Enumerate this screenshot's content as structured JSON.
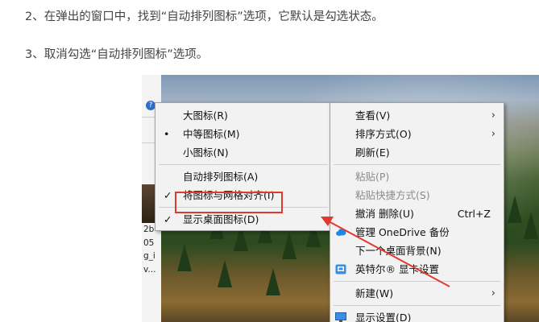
{
  "instructions": {
    "step2": "2、在弹出的窗口中，找到“自动排列图标”选项，它默认是勾选状态。",
    "step3": "3、取消勾选“自动排列图标”选项。"
  },
  "left_strip": {
    "help_glyph": "?",
    "fragments": [
      "2b",
      "05",
      "g_i",
      "v..."
    ]
  },
  "view_submenu": {
    "items": [
      {
        "label": "大图标(R)",
        "mark": ""
      },
      {
        "label": "中等图标(M)",
        "mark": "•"
      },
      {
        "label": "小图标(N)",
        "mark": ""
      },
      {
        "label": "自动排列图标(A)",
        "mark": ""
      },
      {
        "label": "将图标与网格对齐(I)",
        "mark": "✓"
      },
      {
        "label": "显示桌面图标(D)",
        "mark": "✓"
      }
    ]
  },
  "main_menu": {
    "items": [
      {
        "label": "查看(V)",
        "arrow": "›"
      },
      {
        "label": "排序方式(O)",
        "arrow": "›"
      },
      {
        "label": "刷新(E)"
      },
      {
        "label": "粘贴(P)",
        "disabled": true
      },
      {
        "label": "粘贴快捷方式(S)",
        "disabled": true
      },
      {
        "label": "撤消 删除(U)",
        "shortcut": "Ctrl+Z"
      },
      {
        "label": "管理 OneDrive 备份",
        "icon": "onedrive-icon"
      },
      {
        "label": "下一个桌面背景(N)"
      },
      {
        "label": "英特尔® 显卡设置",
        "icon": "intel-graphics-icon"
      },
      {
        "label": "新建(W)",
        "arrow": "›"
      },
      {
        "label": "显示设置(D)",
        "icon": "display-settings-icon"
      }
    ]
  },
  "colors": {
    "highlight": "#e03a2f",
    "arrow": "#e03a2f",
    "onedrive": "#1e88e5",
    "intel": "#3a8ee6"
  }
}
